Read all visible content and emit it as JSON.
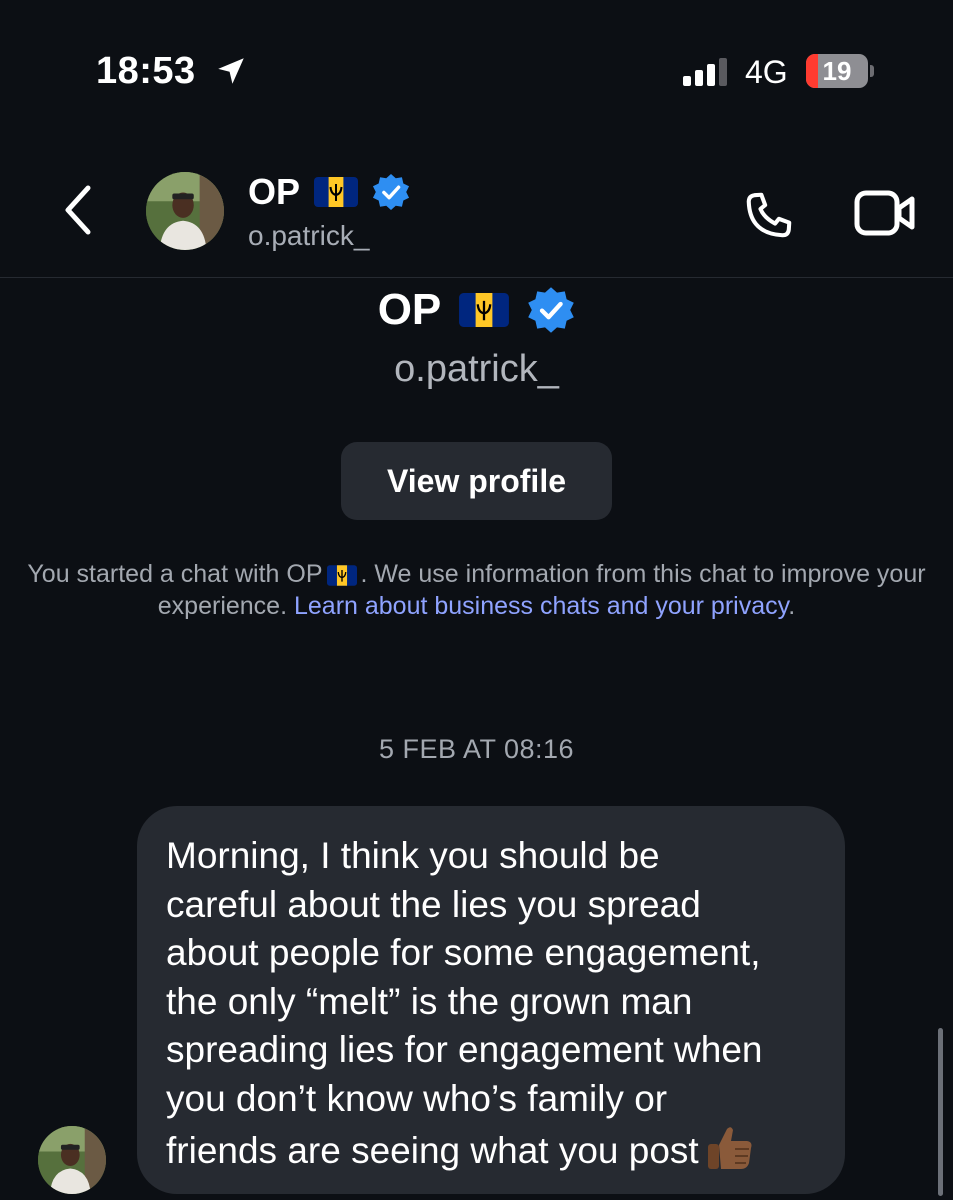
{
  "status_bar": {
    "time": "18:53",
    "network": "4G",
    "battery_level": "19",
    "battery_fraction": 0.19,
    "icons": [
      "location-arrow-icon",
      "signal-bars-icon",
      "battery-icon"
    ]
  },
  "header": {
    "name": "OP",
    "username": "o.patrick_",
    "icons": [
      "back-chevron-icon",
      "barbados-flag-icon",
      "verified-badge-icon",
      "phone-icon",
      "video-camera-icon"
    ]
  },
  "profile": {
    "name": "OP",
    "username": "o.patrick_",
    "view_profile_label": "View profile"
  },
  "privacy_note": {
    "prefix": "You started a chat with OP",
    "middle": ". We use information from this chat to improve your experience.",
    "link": "Learn about business chats and your privacy",
    "suffix": "."
  },
  "thread": {
    "date": "5 FEB AT 08:16",
    "messages": [
      {
        "sender": "o.patrick_",
        "text": "Morning, I think you should be\ncareful about the lies you spread\nabout people for some engagement,\nthe only “melt” is the grown man\nspreading lies for engagement when\nyou don’t know who’s family or\nfriends are seeing what you post",
        "emoji_icon": "thumbs-up-icon"
      }
    ]
  },
  "colors": {
    "background": "#0c0f14",
    "bubble": "#262a31",
    "link": "#8fa3ff",
    "verified": "#2e8ef2",
    "battery_low": "#ff3b30"
  }
}
